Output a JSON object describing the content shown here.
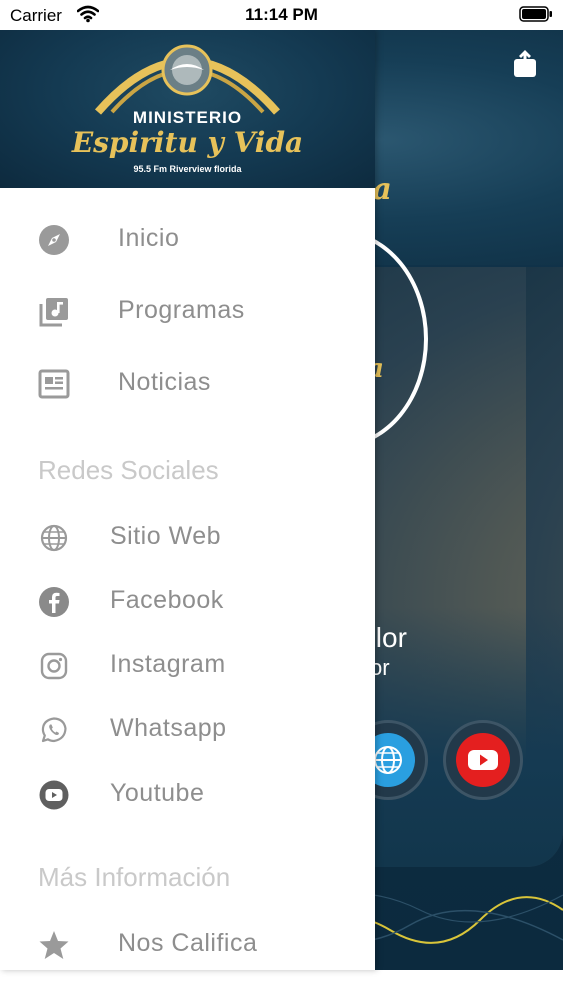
{
  "status_bar": {
    "carrier": "Carrier",
    "time": "11:14 PM"
  },
  "header": {
    "logo_title": "MINISTERIO",
    "logo_script": "Espiritu y Vida",
    "logo_subtitle": "95.5 Fm Riverview florida"
  },
  "menu": {
    "main_items": [
      {
        "label": "Inicio",
        "icon": "compass-icon"
      },
      {
        "label": "Programas",
        "icon": "music-library-icon"
      },
      {
        "label": "Noticias",
        "icon": "newspaper-icon"
      }
    ],
    "social_title": "Redes Sociales",
    "social_items": [
      {
        "label": "Sitio  Web",
        "icon": "globe-icon"
      },
      {
        "label": "Facebook",
        "icon": "facebook-icon"
      },
      {
        "label": "Instagram",
        "icon": "instagram-icon"
      },
      {
        "label": "Whatsapp",
        "icon": "whatsapp-icon"
      },
      {
        "label": "Youtube",
        "icon": "youtube-icon"
      }
    ],
    "info_title": "Más Información",
    "info_items": [
      {
        "label": "Nos  Califica",
        "icon": "star-icon"
      }
    ]
  },
  "player": {
    "title_partial": "Dolor",
    "artist_partial": "or"
  },
  "colors": {
    "brand_dark": "#0f2f45",
    "gold": "#e7c25a",
    "menu_text": "#8e8e8e",
    "section_text": "#c9c9c9",
    "youtube_red": "#e41f1f",
    "web_blue": "#2a9fe0"
  }
}
